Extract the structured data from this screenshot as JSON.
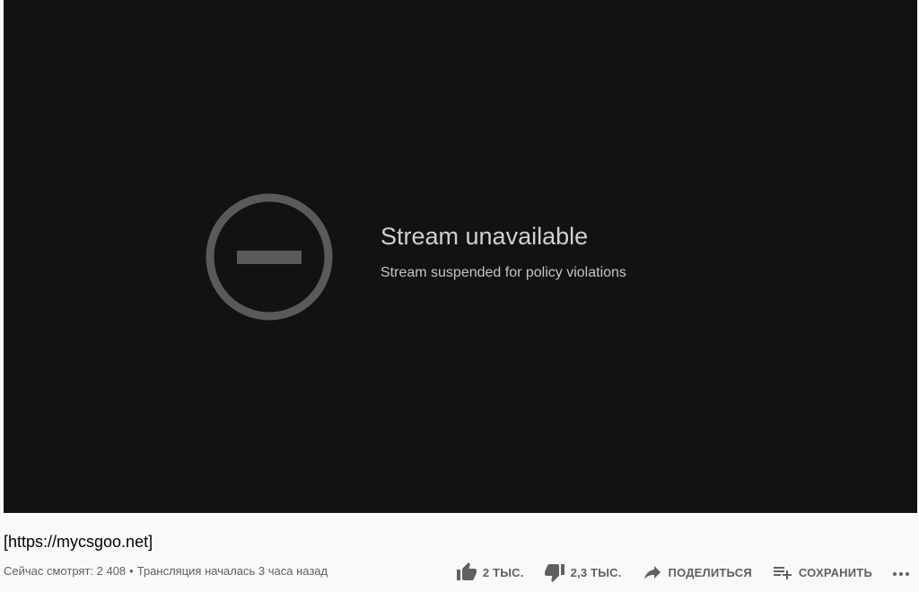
{
  "player": {
    "title": "Stream unavailable",
    "subtitle": "Stream suspended for policy violations",
    "icon": "blocked-circle-icon"
  },
  "video": {
    "title": "[https://mycsgoo.net]",
    "viewers": "Сейчас смотрят: 2 408",
    "separator": "•",
    "started": "Трансляция началась 3 часа назад"
  },
  "actions": {
    "like": {
      "label": "2 ТЫС.",
      "icon": "thumbs-up-icon"
    },
    "dislike": {
      "label": "2,3 ТЫС.",
      "icon": "thumbs-down-icon"
    },
    "share": {
      "label": "ПОДЕЛИТЬСЯ",
      "icon": "share-icon"
    },
    "save": {
      "label": "СОХРАНИТЬ",
      "icon": "playlist-add-icon"
    },
    "more": {
      "icon": "more-horizontal-icon"
    }
  },
  "colors": {
    "player_bg": "#121212",
    "page_bg": "#f9f9f9",
    "icon_gray": "#606060",
    "text_primary": "#030303",
    "text_secondary": "#606060"
  }
}
